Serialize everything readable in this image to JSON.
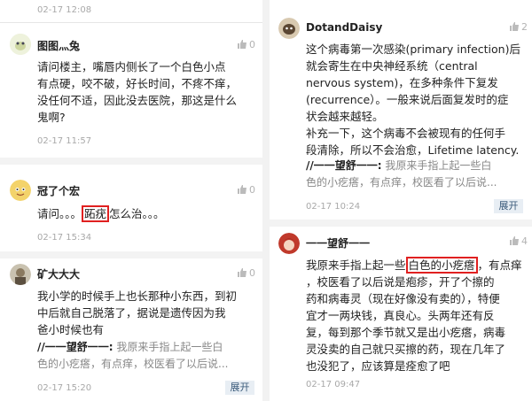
{
  "left": {
    "top_time": "02-17 12:08",
    "comments": [
      {
        "username": "图图灬兔",
        "likes": "0",
        "lines": [
          "请问楼主，嘴唇内侧长了一个白色小点",
          "有点硬，咬不破，好长时间，不疼不痒，",
          "没任何不适，因此没去医院，那这是什么",
          "鬼啊?"
        ],
        "time": "02-17 11:57"
      },
      {
        "username": "冠了个宏",
        "likes": "0",
        "text_before": "请问。。。",
        "highlight": "跖疣",
        "text_after": "怎么治。。。",
        "time": "02-17 15:34"
      },
      {
        "username": "矿大大大",
        "likes": "0",
        "lines": [
          "我小学的时候手上也长那种小东西，到初",
          "中后就自己脱落了，据说是遗传因为我",
          "爸小时候也有"
        ],
        "quote_name": "//一一望舒一一:",
        "quote_lines": [
          " 我原来手指上起一些白",
          "色的小疙瘩，有点痒，校医看了以后说..."
        ],
        "time": "02-17 15:20",
        "expand": "展开"
      }
    ]
  },
  "right": {
    "comments": [
      {
        "username": "DotandDaisy",
        "likes": "2",
        "lines": [
          "这个病毒第一次感染(primary infection)后",
          "就会寄生在中央神经系统（central",
          "nervous system)，在多种条件下复发",
          "(recurrence）。一般来说后面复发时的症",
          "状会越来越轻。",
          "补充一下，这个病毒不会被现有的任何手",
          "段清除，所以不会治愈，Lifetime latency."
        ],
        "quote_name": "//一一望舒一一:",
        "quote_lines": [
          " 我原来手指上起一些白",
          "色的小疙瘩，有点痒，校医看了以后说..."
        ],
        "time": "02-17 10:24",
        "expand": "展开"
      },
      {
        "username": "一一望舒一一",
        "likes": "4",
        "first_before": "我原来手指上起一些",
        "highlight": "白色的小疙瘩",
        "first_after": "，有点痒",
        "lines": [
          "，校医看了以后说是疱疹，开了个擦的",
          "药和病毒灵（现在好像没有卖的），特便",
          "宜才一两块钱，真良心。头两年还有反",
          "复，每到那个季节就又是出小疙瘩，病毒",
          "灵没卖的自己就只买擦的药，现在几年了",
          "也没犯了，应该算是痊愈了吧"
        ],
        "time": "02-17 09:47"
      }
    ]
  },
  "colors": {
    "highlight_border": "#e02020",
    "time_gray": "#a8a8a8",
    "expand_bg": "#e8eef4"
  }
}
